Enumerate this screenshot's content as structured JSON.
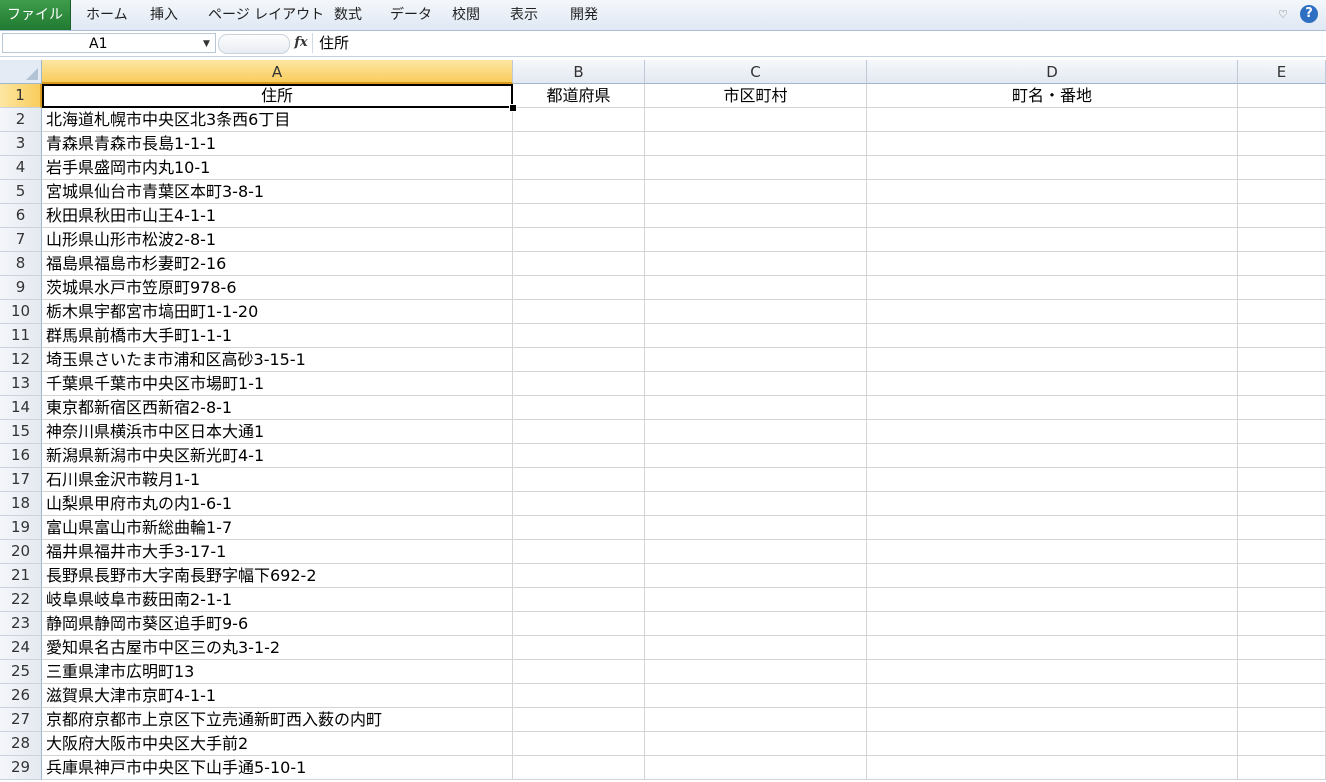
{
  "ribbon": {
    "tabs": [
      "ファイル",
      "ホーム",
      "挿入",
      "ページ レイアウト",
      "数式",
      "データ",
      "校閲",
      "表示",
      "開発"
    ]
  },
  "formula_bar": {
    "name_box": "A1",
    "fx_icon": "fx-icon",
    "formula": "住所"
  },
  "columns": [
    "A",
    "B",
    "C",
    "D",
    "E"
  ],
  "header_row": [
    "住所",
    "都道府県",
    "市区町村",
    "町名・番地",
    ""
  ],
  "rows": [
    "北海道札幌市中央区北3条西6丁目",
    "青森県青森市長島1-1-1",
    "岩手県盛岡市内丸10-1",
    "宮城県仙台市青葉区本町3-8-1",
    "秋田県秋田市山王4-1-1",
    "山形県山形市松波2-8-1",
    "福島県福島市杉妻町2-16",
    "茨城県水戸市笠原町978-6",
    "栃木県宇都宮市塙田町1-1-20",
    "群馬県前橋市大手町1-1-1",
    "埼玉県さいたま市浦和区高砂3-15-1",
    "千葉県千葉市中央区市場町1-1",
    "東京都新宿区西新宿2-8-1",
    "神奈川県横浜市中区日本大通1",
    "新潟県新潟市中央区新光町4-1",
    "石川県金沢市鞍月1-1",
    "山梨県甲府市丸の内1-6-1",
    "富山県富山市新総曲輪1-7",
    "福井県福井市大手3-17-1",
    "長野県長野市大字南長野字幅下692-2",
    "岐阜県岐阜市薮田南2-1-1",
    "静岡県静岡市葵区追手町9-6",
    "愛知県名古屋市中区三の丸3-1-2",
    "三重県津市広明町13",
    "滋賀県大津市京町4-1-1",
    "京都府京都市上京区下立売通新町西入薮の内町",
    "大阪府大阪市中央区大手前2",
    "兵庫県神戸市中央区下山手通5-10-1"
  ],
  "icons": {
    "help": "?",
    "collapse": "♡"
  }
}
